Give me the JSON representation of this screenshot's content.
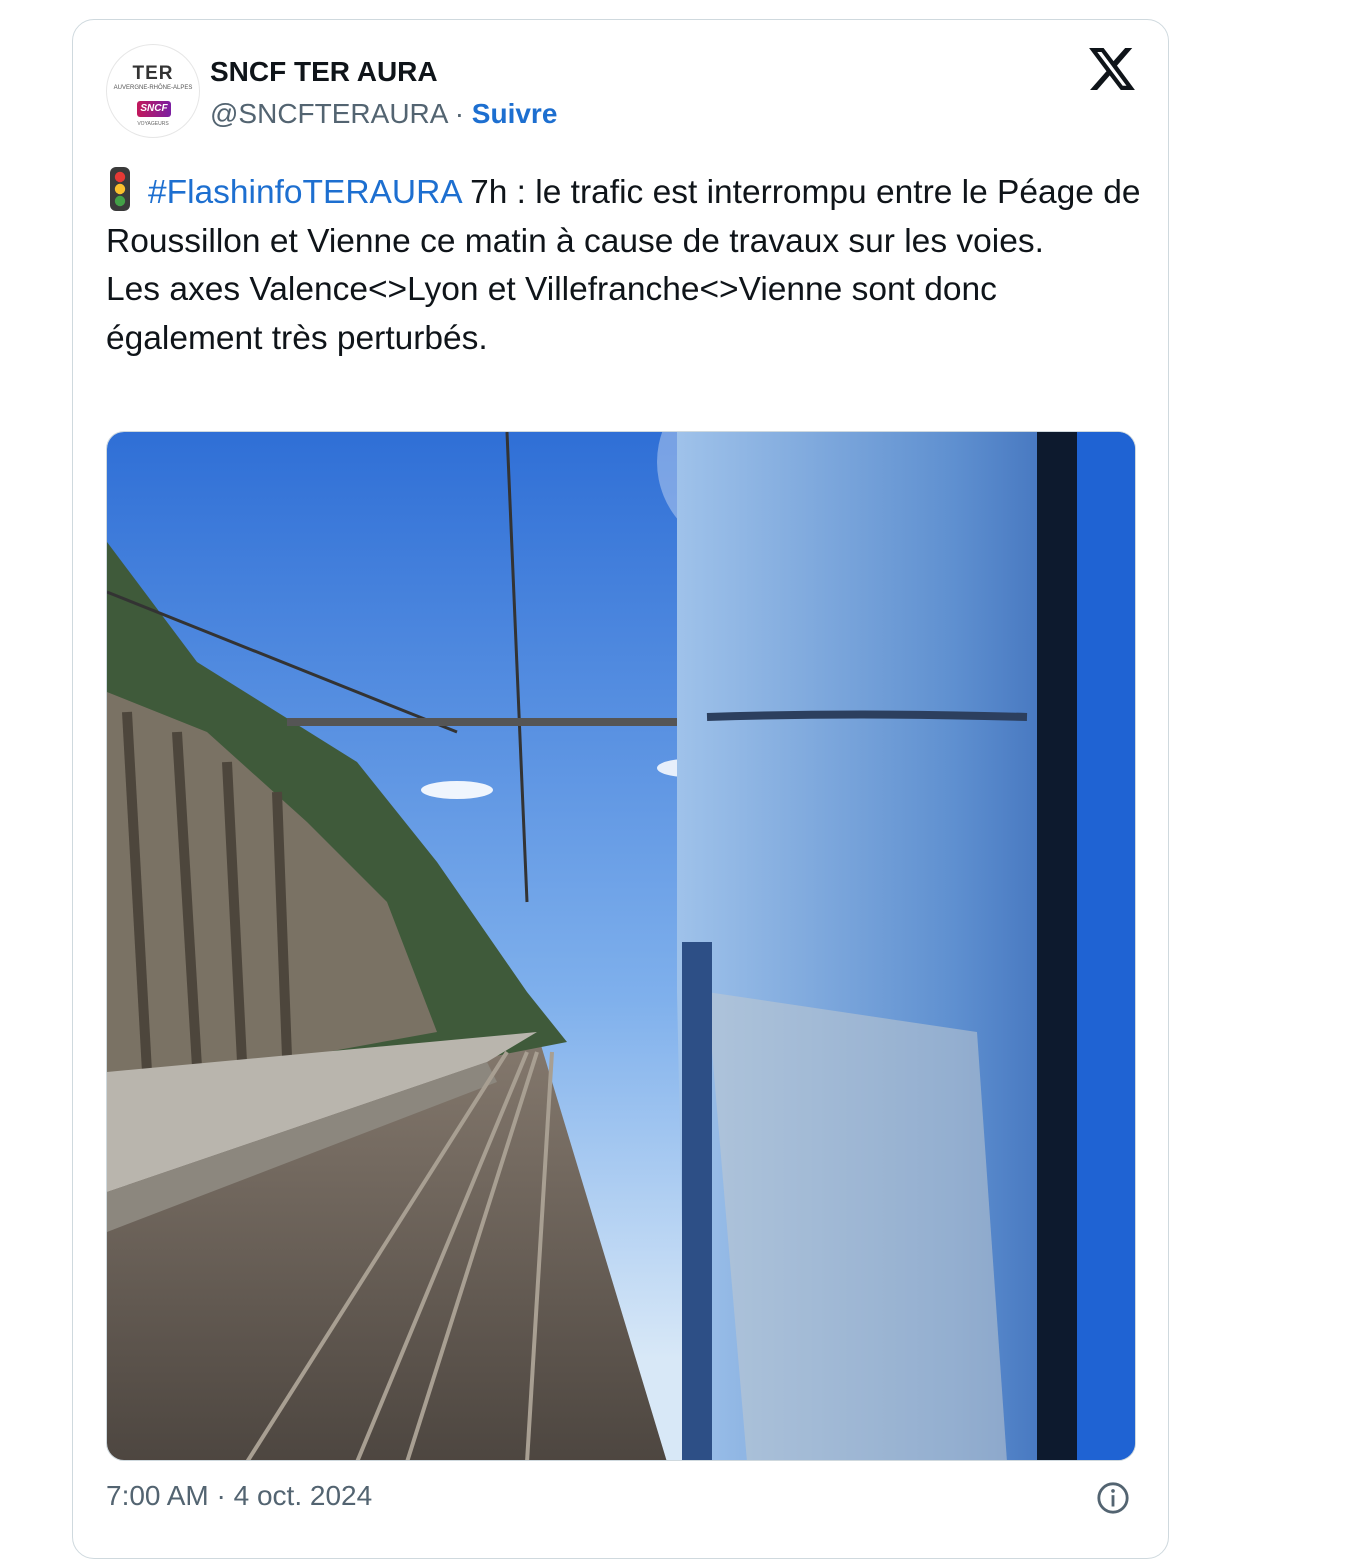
{
  "account": {
    "name": "SNCF TER AURA",
    "handle": "@SNCFTERAURA",
    "separator": "·",
    "follow_label": "Suivre",
    "avatar": {
      "ter": "TER",
      "region": "AUVERGNE-RHÔNE-ALPES",
      "sncf": "SNCF",
      "voyageurs": "VOYAGEURS"
    }
  },
  "tweet": {
    "icon": "traffic-light-icon",
    "hashtag": "#FlashinfoTERAURA",
    "line1_rest": " 7h : le trafic est interrompu entre le Péage de Roussillon et Vienne ce matin à cause de travaux sur les voies.",
    "line2": "Les axes Valence<>Lyon et Villefranche<>Vienne sont donc également très perturbés."
  },
  "media": {
    "description_icon": "railway-photo"
  },
  "footer": {
    "timestamp": "7:00 AM · 4 oct. 2024",
    "info_icon": "info-icon"
  },
  "colors": {
    "link": "#1d6fd0",
    "muted": "#536471",
    "border": "#cfd9de"
  }
}
